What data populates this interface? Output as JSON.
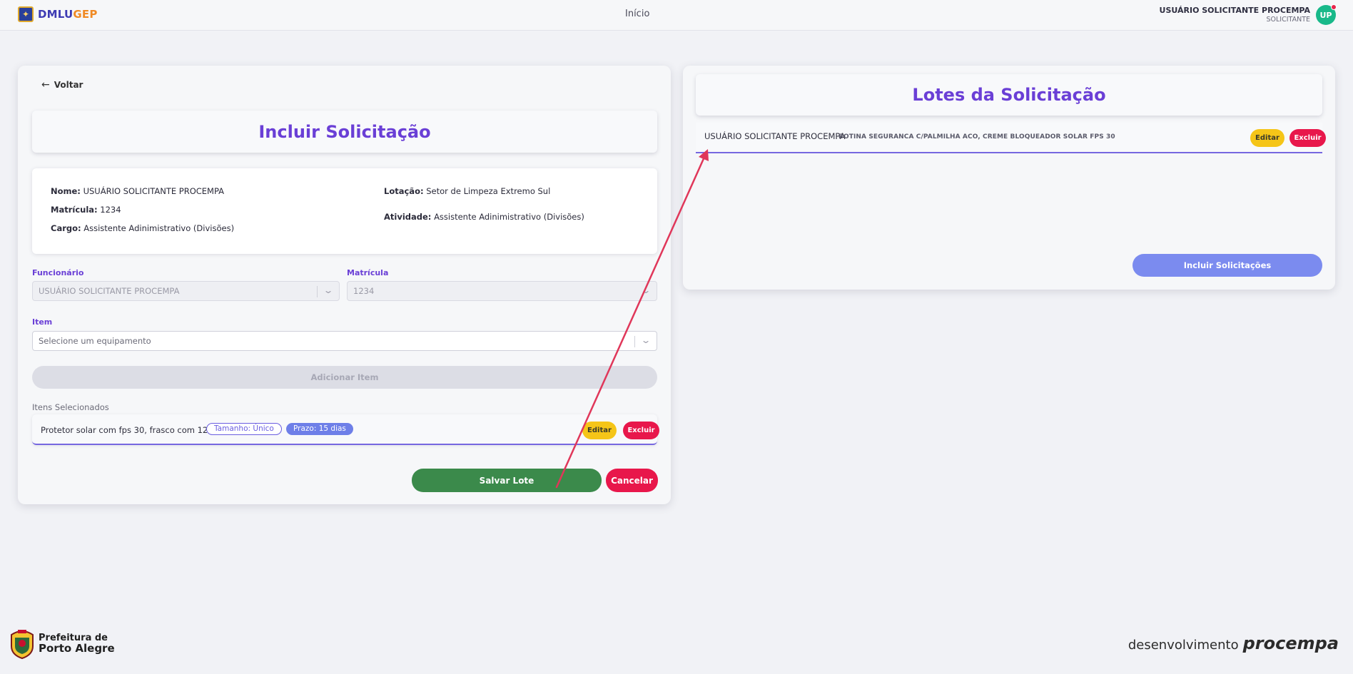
{
  "header": {
    "brand_a": "DMLU",
    "brand_b": "GEP",
    "nav_home": "Início",
    "user_name": "USUÁRIO SOLICITANTE PROCEMPA",
    "user_role": "SOLICITANTE",
    "avatar_initials": "UP"
  },
  "form": {
    "back_label": "Voltar",
    "title": "Incluir Solicitação",
    "info": {
      "nome_label": "Nome:",
      "nome_value": "USUÁRIO SOLICITANTE PROCEMPA",
      "matricula_label": "Matrícula:",
      "matricula_value": "1234",
      "cargo_label": "Cargo:",
      "cargo_value": "Assistente Adinimistrativo (Divisões)",
      "lotacao_label": "Lotação:",
      "lotacao_value": "Setor de Limpeza Extremo Sul",
      "atividade_label": "Atividade:",
      "atividade_value": "Assistente Adinimistrativo (Divisões)"
    },
    "funcionario_label": "Funcionário",
    "funcionario_value": "USUÁRIO SOLICITANTE PROCEMPA",
    "matricula_field_label": "Matrícula",
    "matricula_field_value": "1234",
    "item_label": "Item",
    "item_placeholder": "Selecione um equipamento",
    "add_item_label": "Adicionar Item",
    "selected_label": "Itens Selecionados",
    "selected_item": {
      "name": "Protetor solar com fps 30, frasco com 120ml",
      "size_chip": "Tamanho: Único",
      "deadline_chip": "Prazo: 15 dias",
      "edit_label": "Editar",
      "delete_label": "Excluir"
    },
    "save_label": "Salvar Lote",
    "cancel_label": "Cancelar"
  },
  "lotes": {
    "title": "Lotes da Solicitação",
    "entry": {
      "name": "USUÁRIO SOLICITANTE PROCEMPA",
      "items": "BOTINA SEGURANCA C/PALMILHA ACO, CREME BLOQUEADOR SOLAR FPS 30",
      "edit_label": "Editar",
      "delete_label": "Excluir"
    },
    "include_label": "Incluir Solicitações"
  },
  "footer": {
    "prefeitura_line1": "Prefeitura de",
    "prefeitura_line2": "Porto Alegre",
    "dev_label": "desenvolvimento",
    "dev_brand": "procempa"
  },
  "colors": {
    "accent_purple": "#6a3fd6",
    "save_green": "#3b8a4b",
    "danger_red": "#e8174b",
    "edit_yellow": "#f5c518",
    "annotation_arrow": "#e0375a"
  }
}
